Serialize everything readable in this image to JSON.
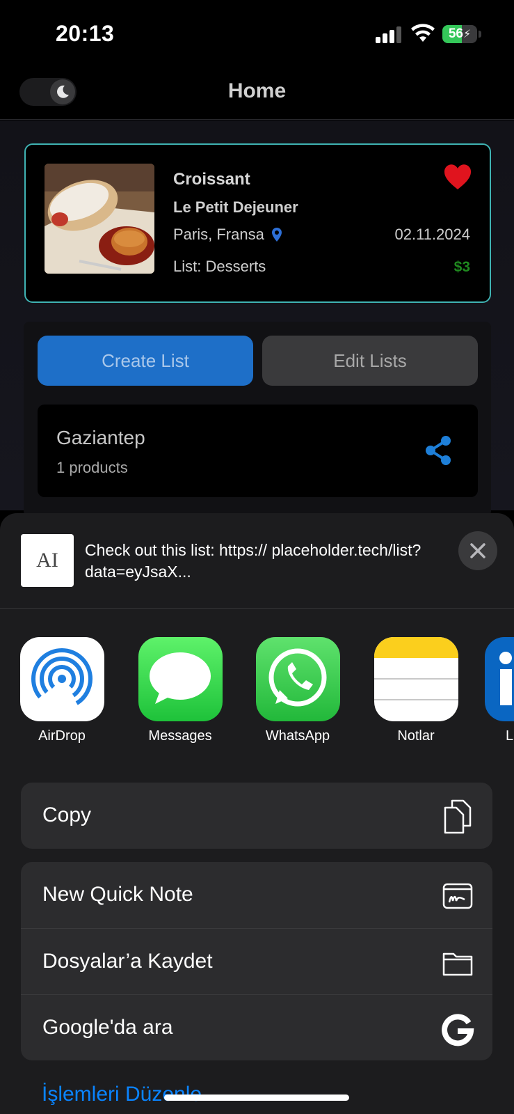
{
  "status_bar": {
    "time": "20:13",
    "battery": "56",
    "battery_level": 0.56
  },
  "nav": {
    "title": "Home"
  },
  "product": {
    "name": "Croissant",
    "vendor": "Le Petit Dejeuner",
    "location": "Paris, Fransa",
    "date": "02.11.2024",
    "list": "List: Desserts",
    "price": "$3"
  },
  "lists_panel": {
    "create_label": "Create List",
    "edit_label": "Edit Lists",
    "items": [
      {
        "name": "Gaziantep",
        "count": "1 products"
      }
    ]
  },
  "share_sheet": {
    "thumb_text": "AI",
    "text": "Check out this list: https:// placeholder.tech/list?data=eyJsaX...",
    "apps": [
      {
        "label": "AirDrop",
        "icon": "airdrop-icon"
      },
      {
        "label": "Messages",
        "icon": "messages-icon"
      },
      {
        "label": "WhatsApp",
        "icon": "whatsapp-icon"
      },
      {
        "label": "Notlar",
        "icon": "notes-icon"
      },
      {
        "label": "L",
        "icon": "linkedin-icon"
      }
    ],
    "copy_label": "Copy",
    "actions": [
      {
        "label": "New Quick Note",
        "icon": "quick-note-icon"
      },
      {
        "label": "Dosyalar’a Kaydet",
        "icon": "folder-icon"
      },
      {
        "label": "Google'da ara",
        "icon": "google-icon"
      }
    ],
    "edit_actions_label": "İşlemleri Düzenle..."
  },
  "colors": {
    "accent": "#1e6fc8",
    "card_border": "#3fb3b3",
    "heart": "#e0141e",
    "price": "#1f8a1f",
    "link": "#0a84ff"
  }
}
